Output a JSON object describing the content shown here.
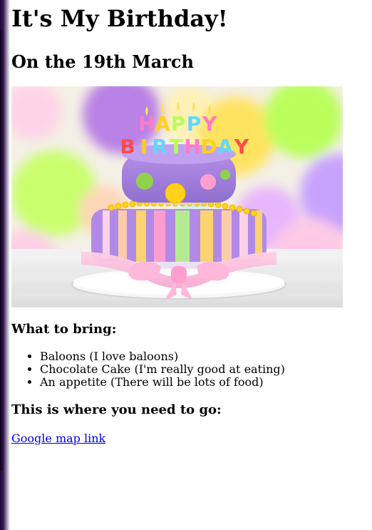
{
  "page": {
    "title": "It's My Birthday!",
    "date_heading": "On the 19th March"
  },
  "image": {
    "semantic": "birthday-cake-photo",
    "cake_topper_text": "HAPPY BIRTHDAY"
  },
  "bring": {
    "heading": "What to bring:",
    "items": [
      "Baloons (I love baloons)",
      "Chocolate Cake (I'm really good at eating)",
      "An appetite (There will be lots of food)"
    ]
  },
  "location": {
    "heading": "This is where you need to go:",
    "link_text": "Google map link"
  },
  "colors": {
    "link": "#0000ee",
    "text": "#000000",
    "background": "#ffffff"
  }
}
